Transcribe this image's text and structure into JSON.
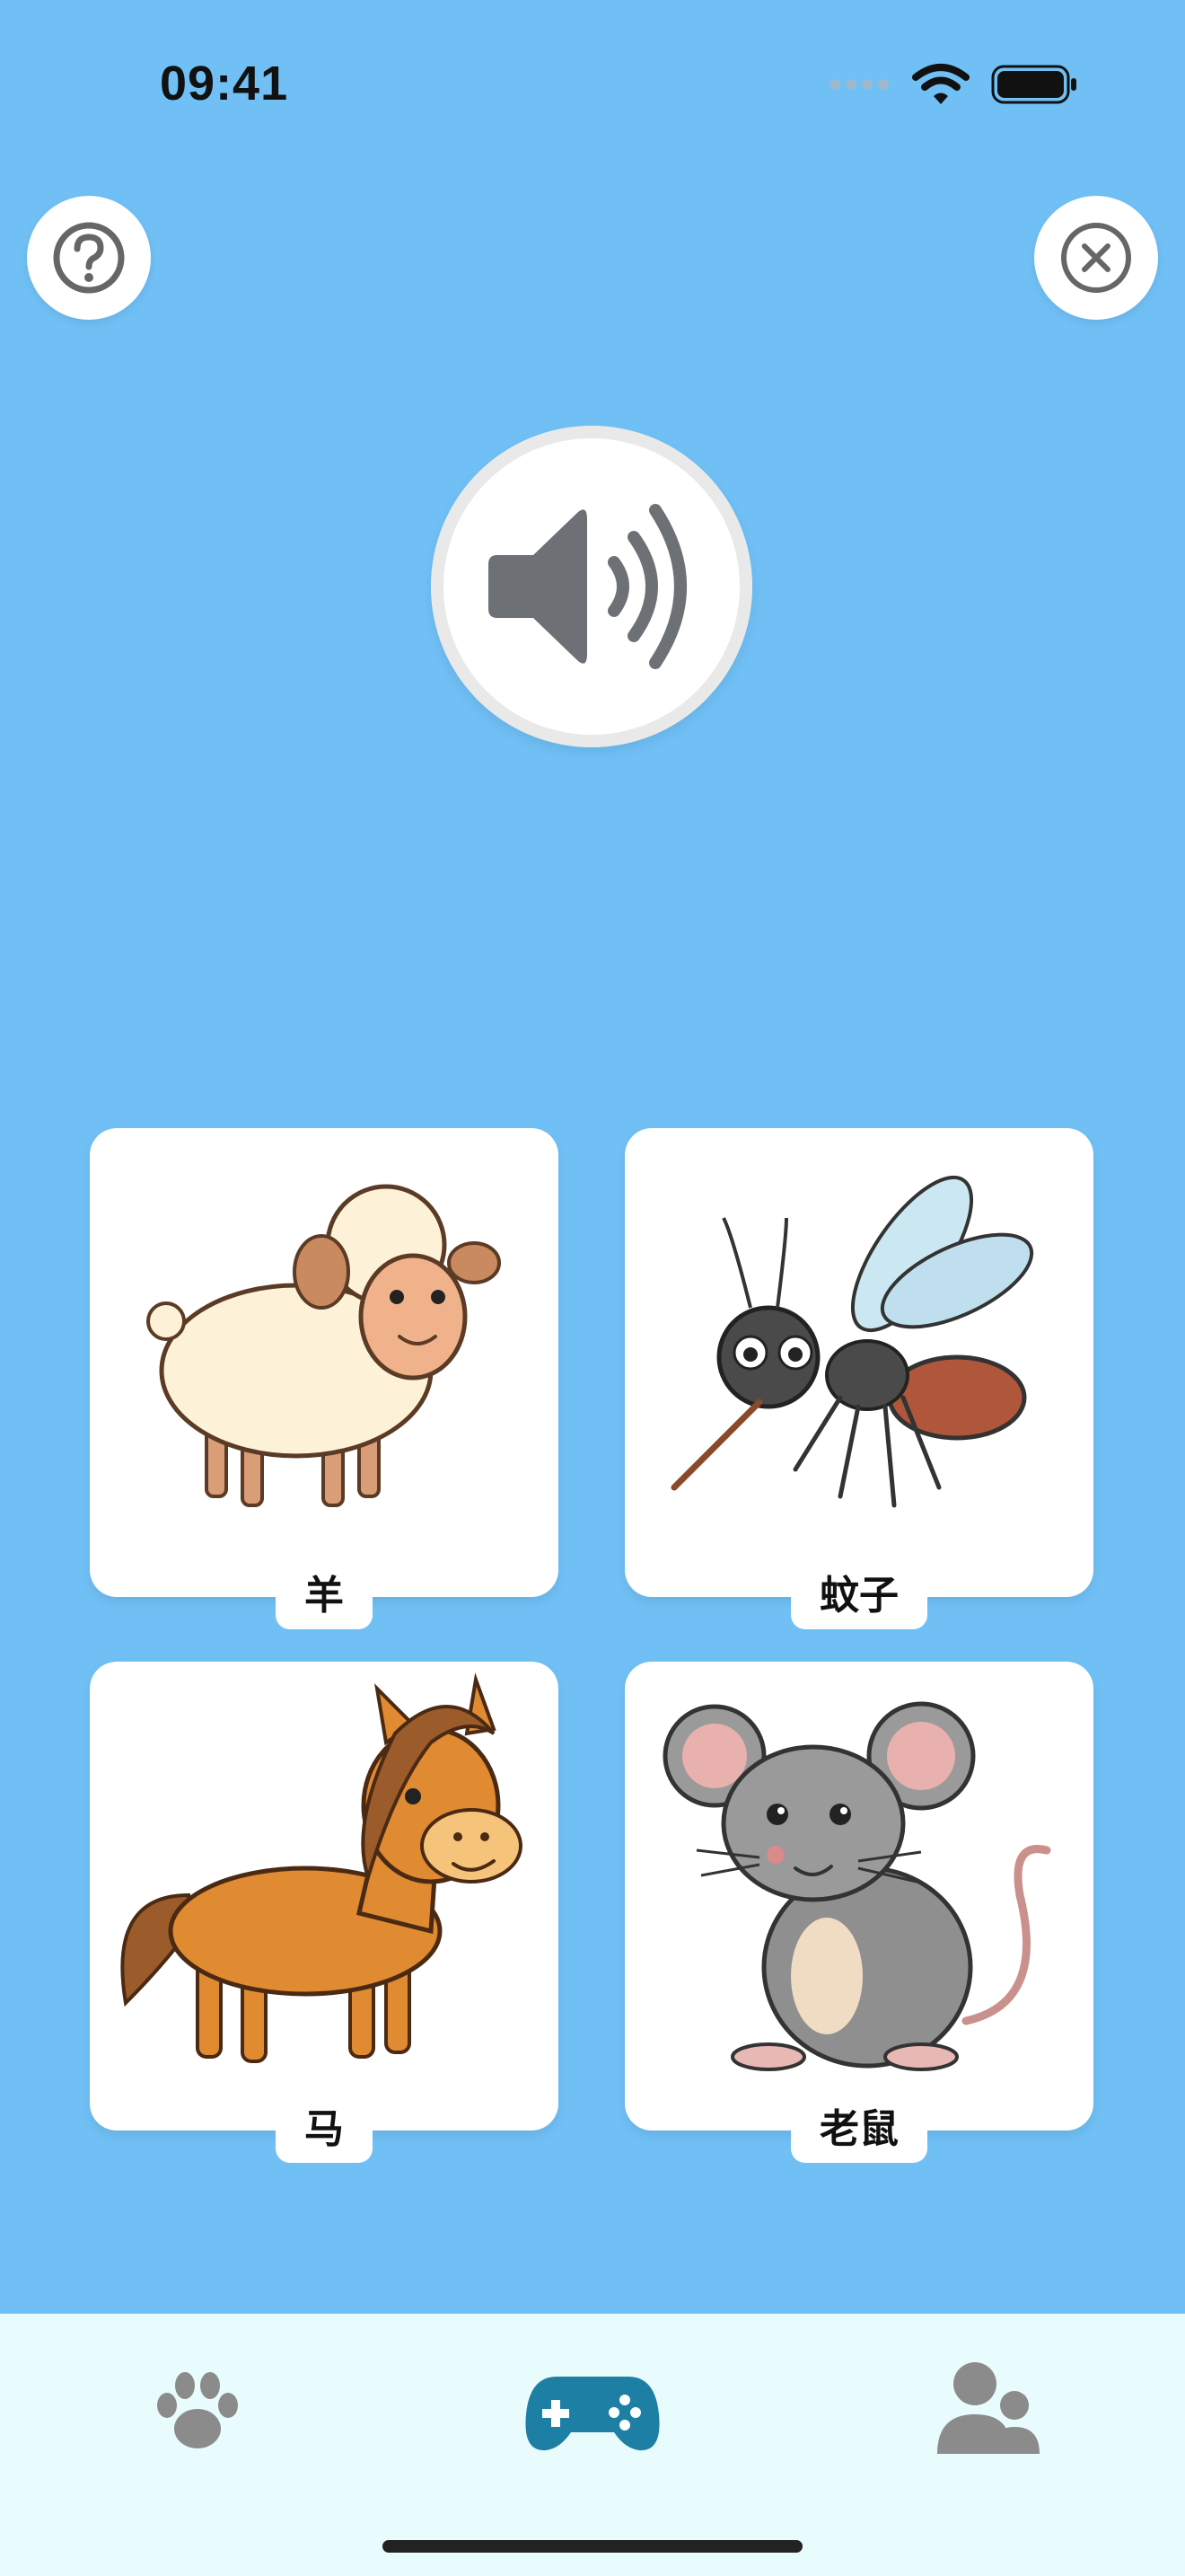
{
  "status_bar": {
    "time": "09:41"
  },
  "toolbar": {
    "help_icon": "question-circle-icon",
    "close_icon": "close-circle-icon"
  },
  "sound_button": {
    "icon": "speaker-icon"
  },
  "choices": [
    {
      "label": "羊",
      "image": "sheep"
    },
    {
      "label": "蚊子",
      "image": "mosquito"
    },
    {
      "label": "马",
      "image": "horse"
    },
    {
      "label": "老鼠",
      "image": "mouse"
    }
  ],
  "tab_bar": {
    "items": [
      {
        "icon": "paw-icon",
        "active": false
      },
      {
        "icon": "gamepad-icon",
        "active": true
      },
      {
        "icon": "users-icon",
        "active": false
      }
    ],
    "colors": {
      "active": "#1d7fa3",
      "inactive": "#8b8b8b"
    }
  },
  "colors": {
    "background": "#70c0f6",
    "card": "#ffffff",
    "tabbar": "#e9fcfd"
  }
}
